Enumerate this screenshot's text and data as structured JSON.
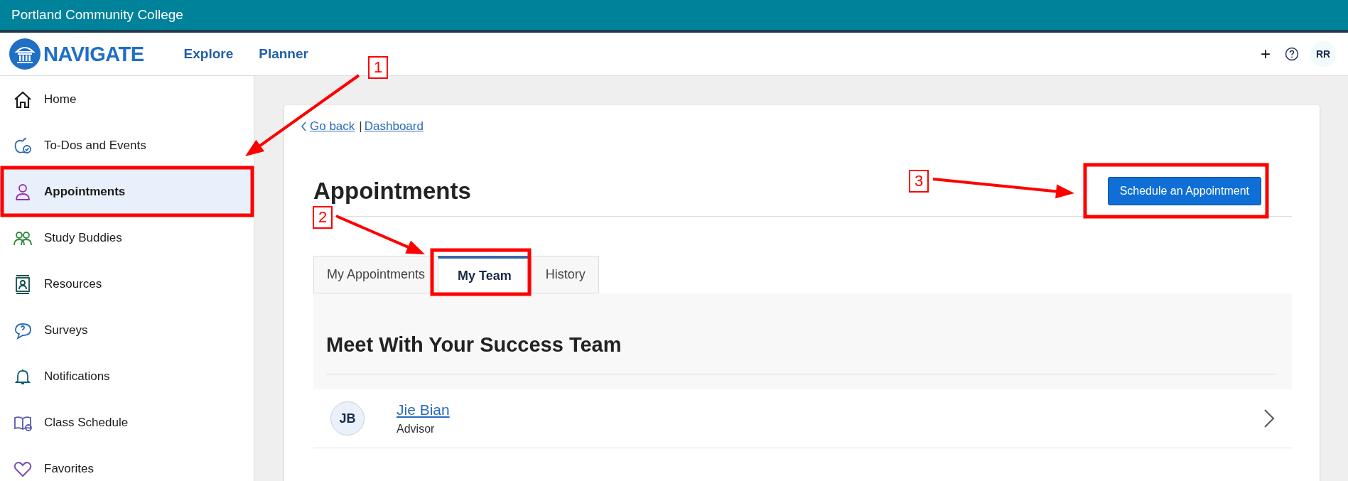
{
  "top_bar": {
    "title": "Portland Community College"
  },
  "header": {
    "logo_text": "NAVIGATE",
    "nav": [
      {
        "label": "Explore"
      },
      {
        "label": "Planner"
      }
    ],
    "actions": {
      "add": "+",
      "avatar": "RR"
    }
  },
  "sidebar": {
    "items": [
      {
        "label": "Home",
        "selected": false
      },
      {
        "label": "To-Dos and Events",
        "selected": false
      },
      {
        "label": "Appointments",
        "selected": true
      },
      {
        "label": "Study Buddies",
        "selected": false
      },
      {
        "label": "Resources",
        "selected": false
      },
      {
        "label": "Surveys",
        "selected": false
      },
      {
        "label": "Notifications",
        "selected": false
      },
      {
        "label": "Class Schedule",
        "selected": false
      },
      {
        "label": "Favorites",
        "selected": false
      }
    ]
  },
  "breadcrumb": {
    "back": "Go back",
    "separator": "|",
    "link": "Dashboard"
  },
  "page": {
    "title": "Appointments",
    "primary_button": "Schedule an Appointment"
  },
  "tabs": [
    {
      "label": "My Appointments",
      "selected": false
    },
    {
      "label": "My Team",
      "selected": true
    },
    {
      "label": "History",
      "selected": false
    }
  ],
  "team": {
    "title": "Meet With Your Success Team",
    "members": [
      {
        "initials": "JB",
        "name": "Jie Bian",
        "role": "Advisor"
      }
    ]
  },
  "annotations": [
    {
      "label": "1"
    },
    {
      "label": "2"
    },
    {
      "label": "3"
    }
  ]
}
